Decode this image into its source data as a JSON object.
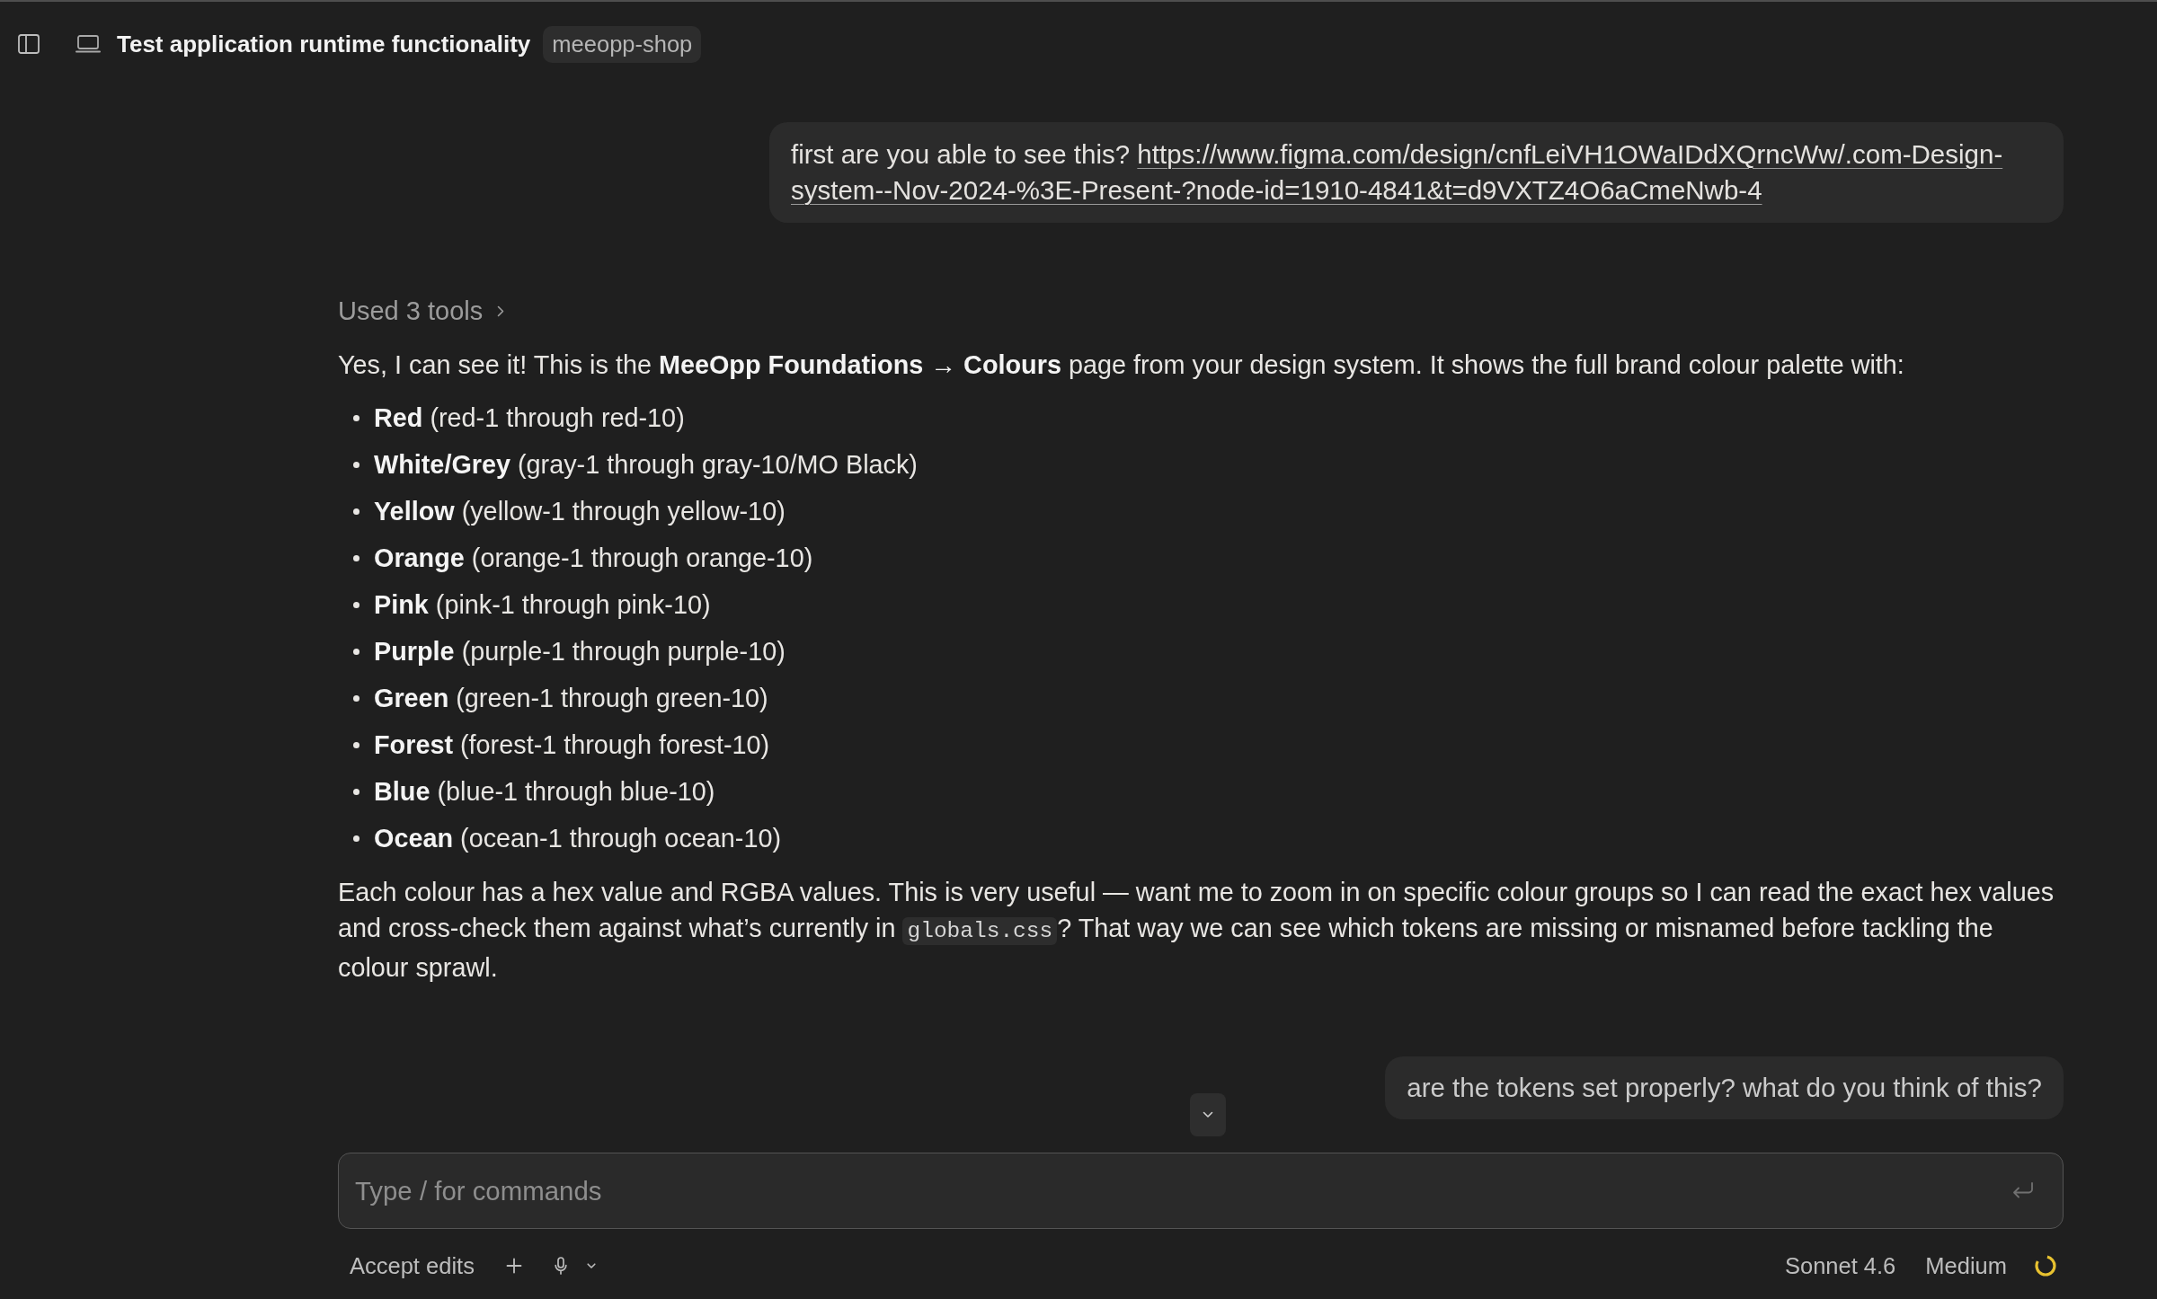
{
  "header": {
    "title": "Test application runtime functionality",
    "project": "meeopp-shop"
  },
  "messages": [
    {
      "kind": "user",
      "segments": [
        {
          "kind": "text",
          "text": "first are you able to see this? "
        },
        {
          "kind": "link",
          "text": "https://www.figma.com/design/cnfLeiVH1OWaIDdXQrncWw/.com-Design-"
        },
        {
          "kind": "link",
          "text": "system--Nov-2024-%3E-Present-?node-id=1910-4841&t=d9VXTZ4O6aCmeNwb-4"
        }
      ]
    },
    {
      "kind": "assistant",
      "tool_summary": "Used 3 tools",
      "intro": "Yes, I can see it! This is the **MeeOpp Foundations → Colours** page from your design system. It shows the full brand colour palette with:",
      "list": [
        "**Red** (red-1 through red-10)",
        "**White/Grey** (gray-1 through gray-10/MO Black)",
        "**Yellow** (yellow-1 through yellow-10)",
        "**Orange** (orange-1 through orange-10)",
        "**Pink** (pink-1 through pink-10)",
        "**Purple** (purple-1 through purple-10)",
        "**Green** (green-1 through green-10)",
        "**Forest** (forest-1 through forest-10)",
        "**Blue** (blue-1 through blue-10)",
        "**Ocean** (ocean-1 through ocean-10)"
      ],
      "outro": [
        {
          "kind": "text",
          "text": "Each colour has a hex value and RGBA values. This is very useful — want me to zoom in on specific colour groups so I can read the exact hex values and cross-check them against what’s currently in "
        },
        {
          "kind": "code",
          "text": "globals.css"
        },
        {
          "kind": "text",
          "text": "? That way we can see which tokens are missing or misnamed before tackling the colour sprawl."
        }
      ]
    },
    {
      "kind": "user",
      "segments": [
        {
          "kind": "text",
          "text": "are the tokens set properly? what do you think of this?"
        }
      ]
    }
  ],
  "composer": {
    "placeholder": "Type / for commands"
  },
  "footer": {
    "mode": "Accept edits",
    "model": "Sonnet 4.6",
    "effort": "Medium"
  }
}
